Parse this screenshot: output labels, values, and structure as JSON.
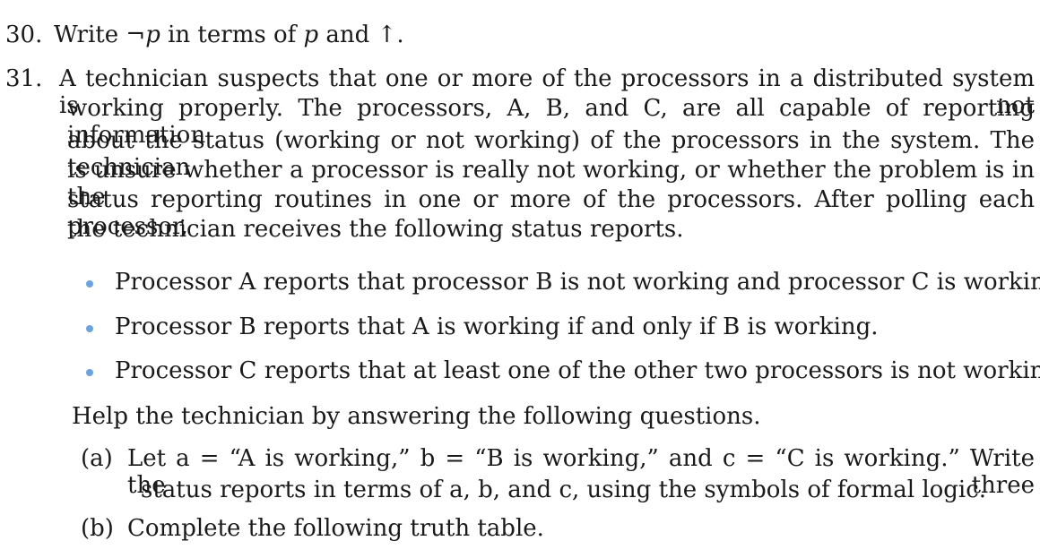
{
  "q30": {
    "number": "30.",
    "text_a": "Write ",
    "not_p": "¬p",
    "text_b": " in terms of ",
    "p": "p",
    "text_c": " and ↑."
  },
  "q31": {
    "number": "31.",
    "para_lines": [
      "A technician suspects that one or more of the processors in a distributed system is not",
      "working properly. The processors, A, B, and C, are all capable of reporting information",
      "about the status (working or not working) of the processors in the system. The technician",
      "is unsure whether a processor is really not working, or whether the problem is in the",
      "status reporting routines in one or more of the processors. After polling each processor,",
      "the technician receives the following status reports."
    ],
    "bullets": [
      "Processor A reports that processor B is not working and processor C is working.",
      "Processor B reports that A is working if and only if B is working.",
      "Processor C reports that at least one of the other two processors is not working."
    ],
    "help_line": "Help the technician by answering the following questions.",
    "part_a_label": "(a)",
    "part_a_line1": "Let a = “A is working,” b = “B is working,” and c = “C is working.” Write the three",
    "part_a_line2": "status reports in terms of a, b, and c, using the symbols of formal logic.",
    "part_b_label": "(b)",
    "part_b_text": "Complete the following truth table."
  }
}
